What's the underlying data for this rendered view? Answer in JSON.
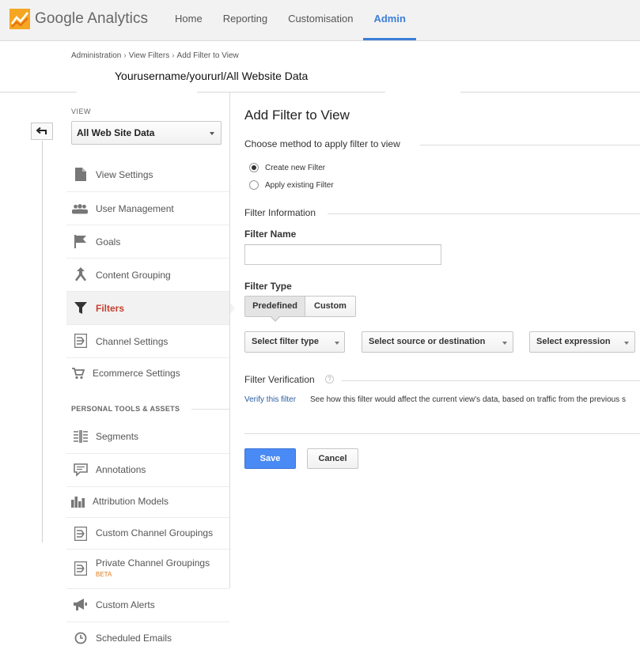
{
  "nav": {
    "logo_google": "Google",
    "logo_product": "Analytics",
    "items": [
      {
        "label": "Home",
        "active": false
      },
      {
        "label": "Reporting",
        "active": false
      },
      {
        "label": "Customisation",
        "active": false
      },
      {
        "label": "Admin",
        "active": true
      }
    ],
    "accent_color": "#3d7ed8"
  },
  "breadcrumb": {
    "items": [
      "Administration",
      "View Filters",
      "Add Filter to View"
    ],
    "separator": "›"
  },
  "account_path": "Yourusername/yoururl/All Website Data",
  "sidebar": {
    "view_label": "VIEW",
    "view_selected": "All Web Site Data",
    "items": [
      {
        "label": "View Settings",
        "icon": "document-icon"
      },
      {
        "label": "User Management",
        "icon": "users-icon"
      },
      {
        "label": "Goals",
        "icon": "flag-icon"
      },
      {
        "label": "Content Grouping",
        "icon": "content-grouping-icon"
      },
      {
        "label": "Filters",
        "icon": "filter-icon",
        "active": true
      },
      {
        "label": "Channel Settings",
        "icon": "channel-icon"
      },
      {
        "label": "Ecommerce Settings",
        "icon": "cart-icon"
      }
    ],
    "section_title": "PERSONAL TOOLS & ASSETS",
    "tools": [
      {
        "label": "Segments",
        "icon": "segments-icon"
      },
      {
        "label": "Annotations",
        "icon": "annotation-icon"
      },
      {
        "label": "Attribution Models",
        "icon": "bar-chart-icon"
      },
      {
        "label": "Custom Channel Groupings",
        "icon": "channel-icon"
      },
      {
        "label": "Private Channel Groupings",
        "icon": "channel-icon",
        "badge": "BETA"
      },
      {
        "label": "Custom Alerts",
        "icon": "megaphone-icon"
      },
      {
        "label": "Scheduled Emails",
        "icon": "clock-icon"
      }
    ],
    "active_color": "#c6412f",
    "beta_color": "#e07c1a"
  },
  "main": {
    "title": "Add Filter to View",
    "method_legend": "Choose method to apply filter to view",
    "method_options": [
      {
        "label": "Create new Filter",
        "checked": true
      },
      {
        "label": "Apply existing Filter",
        "checked": false
      }
    ],
    "info_legend": "Filter Information",
    "filter_name_label": "Filter Name",
    "filter_name_value": "",
    "filter_type_label": "Filter Type",
    "filter_type_tabs": [
      "Predefined",
      "Custom"
    ],
    "dropdowns": [
      "Select filter type",
      "Select source or destination",
      "Select expression"
    ],
    "verification_legend": "Filter Verification",
    "help_glyph": "?",
    "verify_link": "Verify this filter",
    "verify_desc": "See how this filter would affect the current view's data, based on traffic from the previous s",
    "save_label": "Save",
    "cancel_label": "Cancel",
    "save_color": "#4a8af4"
  }
}
